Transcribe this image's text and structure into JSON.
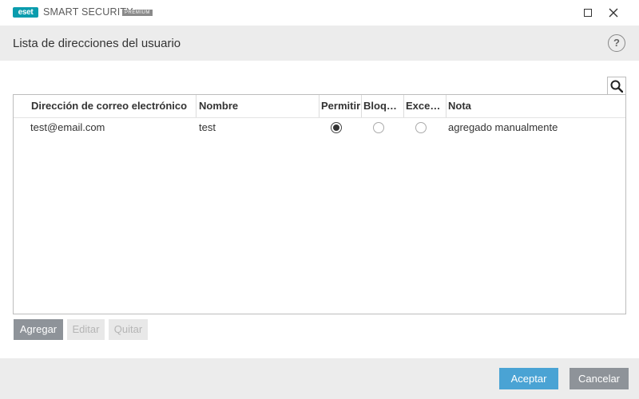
{
  "window": {
    "logo_text": "eset",
    "app_name": "SMART SECURITY",
    "edition": "PREMIUM"
  },
  "header": {
    "title": "Lista de direcciones del usuario",
    "help_label": "?"
  },
  "table": {
    "columns": [
      {
        "key": "email",
        "label": "Dirección de correo electrónico"
      },
      {
        "key": "name",
        "label": "Nombre"
      },
      {
        "key": "allow",
        "label": "Permitir"
      },
      {
        "key": "block",
        "label": "Bloquear"
      },
      {
        "key": "exception",
        "label": "Excepción"
      },
      {
        "key": "note",
        "label": "Nota"
      }
    ],
    "rows": [
      {
        "email": "test@email.com",
        "name": "test",
        "allow": true,
        "block": false,
        "exception": false,
        "note": "agregado manualmente"
      }
    ]
  },
  "list_actions": {
    "add": "Agregar",
    "edit": "Editar",
    "remove": "Quitar"
  },
  "dialog_actions": {
    "ok": "Aceptar",
    "cancel": "Cancelar"
  },
  "colors": {
    "brand": "#0a9cad",
    "ok_button": "#4aa3d4",
    "neutral_button": "#8e9399",
    "header_bg": "#ececec"
  }
}
